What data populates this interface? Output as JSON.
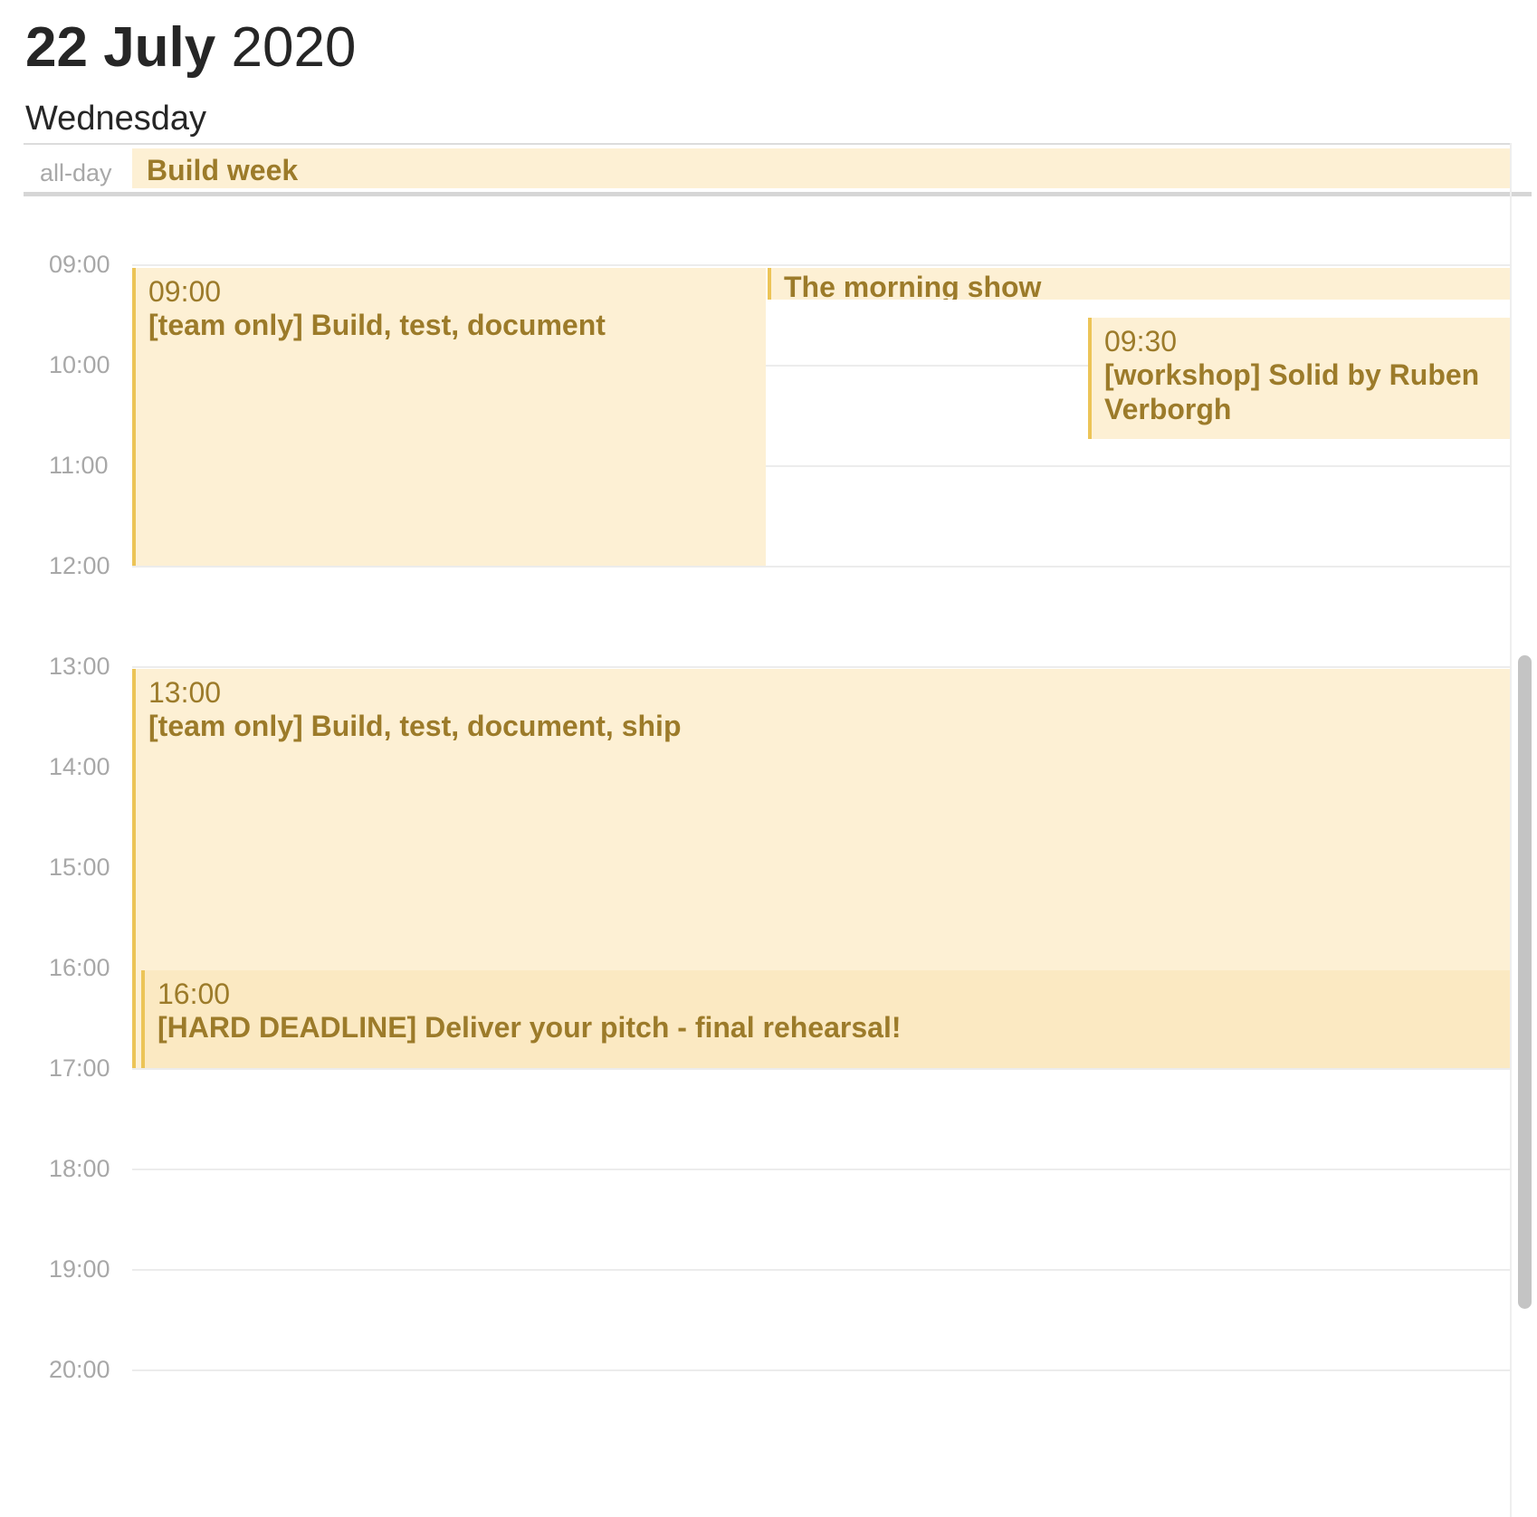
{
  "header": {
    "day_month": "22 July",
    "year": "2020",
    "weekday": "Wednesday"
  },
  "allday": {
    "label": "all-day",
    "event_title": "Build week"
  },
  "hours": [
    "09:00",
    "10:00",
    "11:00",
    "12:00",
    "13:00",
    "14:00",
    "15:00",
    "16:00",
    "17:00",
    "18:00",
    "19:00",
    "20:00"
  ],
  "events": [
    {
      "time": "09:00",
      "title": "[team only] Build, test, document"
    },
    {
      "title": "The morning show"
    },
    {
      "time": "09:30",
      "title": "[workshop] Solid by Ruben Verborgh"
    },
    {
      "time": "13:00",
      "title": "[team only] Build, test, document, ship"
    },
    {
      "time": "16:00",
      "title": "[HARD DEADLINE] Deliver your pitch - final rehearsal!"
    }
  ],
  "colors": {
    "event_background": "#fdf0d4",
    "event_background_overlap": "#fbe9c2",
    "event_accent": "#ecc457",
    "event_text": "#9c7b2a",
    "hour_label": "#a8a8a8"
  }
}
